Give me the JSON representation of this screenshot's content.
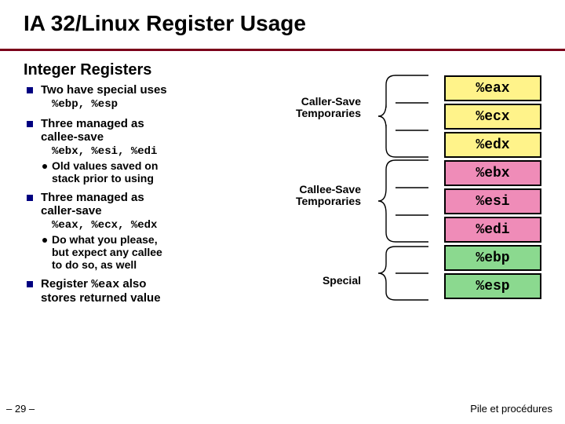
{
  "title": "IA 32/Linux Register Usage",
  "subtitle": "Integer Registers",
  "bullets": {
    "b1": "Two have special uses",
    "b1_sub": "%ebp, %esp",
    "b2a": "Three managed as",
    "b2b": "callee-save",
    "b2_sub": "%ebx, %esi, %edi",
    "b2_dot_a": "Old values saved on",
    "b2_dot_b": "stack prior to using",
    "b3a": "Three managed as",
    "b3b": "caller-save",
    "b3_sub": "%eax, %ecx, %edx",
    "b3_dot_a": "Do what you please,",
    "b3_dot_b": "but expect any callee",
    "b3_dot_c": "to do so, as well",
    "b4a": "Register ",
    "b4reg": "%eax",
    "b4b": " also",
    "b4c": "stores returned value"
  },
  "labels": {
    "caller_a": "Caller-Save",
    "caller_b": "Temporaries",
    "callee_a": "Callee-Save",
    "callee_b": "Temporaries",
    "special": "Special"
  },
  "registers": {
    "eax": "%eax",
    "ecx": "%ecx",
    "edx": "%edx",
    "ebx": "%ebx",
    "esi": "%esi",
    "edi": "%edi",
    "ebp": "%ebp",
    "esp": "%esp"
  },
  "footer": {
    "left": "– 29 –",
    "right": "Pile et procédures"
  }
}
